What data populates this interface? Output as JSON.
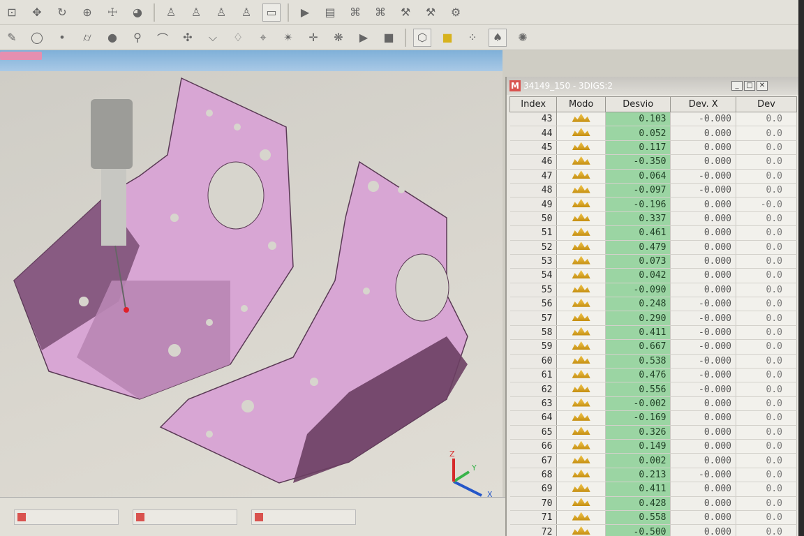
{
  "table_window": {
    "title": "34149_150 - 3DIGS:2",
    "columns": [
      "Index",
      "Modo",
      "Desvio",
      "Dev. X",
      "Dev"
    ],
    "rows": [
      {
        "index": "43",
        "desvio": "0.103",
        "devx": "-0.000",
        "dev": "0.0"
      },
      {
        "index": "44",
        "desvio": "0.052",
        "devx": "0.000",
        "dev": "0.0"
      },
      {
        "index": "45",
        "desvio": "0.117",
        "devx": "0.000",
        "dev": "0.0"
      },
      {
        "index": "46",
        "desvio": "-0.350",
        "devx": "0.000",
        "dev": "0.0"
      },
      {
        "index": "47",
        "desvio": "0.064",
        "devx": "-0.000",
        "dev": "0.0"
      },
      {
        "index": "48",
        "desvio": "-0.097",
        "devx": "-0.000",
        "dev": "0.0"
      },
      {
        "index": "49",
        "desvio": "-0.196",
        "devx": "0.000",
        "dev": "-0.0"
      },
      {
        "index": "50",
        "desvio": "0.337",
        "devx": "0.000",
        "dev": "0.0"
      },
      {
        "index": "51",
        "desvio": "0.461",
        "devx": "0.000",
        "dev": "0.0"
      },
      {
        "index": "52",
        "desvio": "0.479",
        "devx": "0.000",
        "dev": "0.0"
      },
      {
        "index": "53",
        "desvio": "0.073",
        "devx": "0.000",
        "dev": "0.0"
      },
      {
        "index": "54",
        "desvio": "0.042",
        "devx": "0.000",
        "dev": "0.0"
      },
      {
        "index": "55",
        "desvio": "-0.090",
        "devx": "0.000",
        "dev": "0.0"
      },
      {
        "index": "56",
        "desvio": "0.248",
        "devx": "-0.000",
        "dev": "0.0"
      },
      {
        "index": "57",
        "desvio": "0.290",
        "devx": "-0.000",
        "dev": "0.0"
      },
      {
        "index": "58",
        "desvio": "0.411",
        "devx": "-0.000",
        "dev": "0.0"
      },
      {
        "index": "59",
        "desvio": "0.667",
        "devx": "-0.000",
        "dev": "0.0"
      },
      {
        "index": "60",
        "desvio": "0.538",
        "devx": "-0.000",
        "dev": "0.0"
      },
      {
        "index": "61",
        "desvio": "0.476",
        "devx": "-0.000",
        "dev": "0.0"
      },
      {
        "index": "62",
        "desvio": "0.556",
        "devx": "-0.000",
        "dev": "0.0"
      },
      {
        "index": "63",
        "desvio": "-0.002",
        "devx": "0.000",
        "dev": "0.0"
      },
      {
        "index": "64",
        "desvio": "-0.169",
        "devx": "0.000",
        "dev": "0.0"
      },
      {
        "index": "65",
        "desvio": "0.326",
        "devx": "0.000",
        "dev": "0.0"
      },
      {
        "index": "66",
        "desvio": "0.149",
        "devx": "0.000",
        "dev": "0.0"
      },
      {
        "index": "67",
        "desvio": "0.002",
        "devx": "0.000",
        "dev": "0.0"
      },
      {
        "index": "68",
        "desvio": "0.213",
        "devx": "-0.000",
        "dev": "0.0"
      },
      {
        "index": "69",
        "desvio": "0.411",
        "devx": "0.000",
        "dev": "0.0"
      },
      {
        "index": "70",
        "desvio": "0.428",
        "devx": "0.000",
        "dev": "0.0"
      },
      {
        "index": "71",
        "desvio": "0.558",
        "devx": "0.000",
        "dev": "0.0"
      },
      {
        "index": "72",
        "desvio": "-0.500",
        "devx": "0.000",
        "dev": "0.0"
      }
    ]
  },
  "viewport": {
    "axis_labels": {
      "x": "X",
      "y": "Y",
      "z": "Z"
    }
  },
  "colors": {
    "part": "#d8a6d4",
    "part_dark": "#6b3f63",
    "desvio_bg": "#9bd5a3",
    "accent_title": "#7fb0d8",
    "axis_x": "#2456c8",
    "axis_y": "#39b34a",
    "axis_z": "#d62a2a"
  }
}
